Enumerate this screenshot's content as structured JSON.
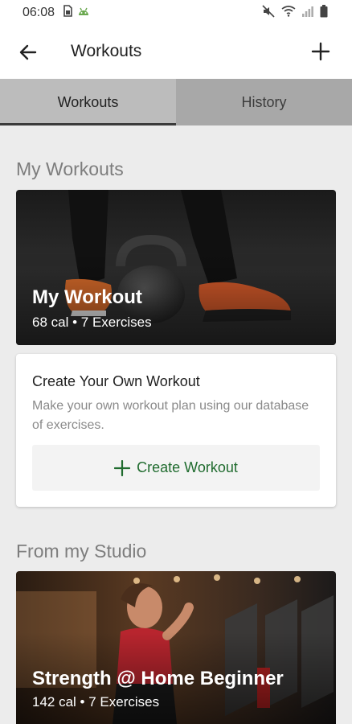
{
  "status_bar": {
    "time": "06:08",
    "icons": [
      "sim-icon",
      "android-icon"
    ],
    "right_icons": [
      "mute-icon",
      "wifi-icon",
      "signal-icon",
      "battery-icon"
    ]
  },
  "app_bar": {
    "title": "Workouts",
    "back_icon": "arrow-left-icon",
    "add_icon": "plus-icon"
  },
  "tabs": [
    {
      "label": "Workouts",
      "active": true
    },
    {
      "label": "History",
      "active": false
    }
  ],
  "my_workouts": {
    "section_title": "My Workouts",
    "card": {
      "title": "My Workout",
      "subtitle": "68 cal • 7 Exercises"
    }
  },
  "create_card": {
    "heading": "Create Your Own Workout",
    "description": "Make your own workout plan using our database of exercises.",
    "button_label": "Create Workout"
  },
  "studio": {
    "section_title": "From my Studio",
    "card": {
      "title": "Strength @ Home Beginner",
      "subtitle": "142 cal • 7 Exercises"
    }
  },
  "colors": {
    "accent": "#1f6b2e",
    "tab_bar": "#a8a8a8",
    "background": "#ececec"
  }
}
